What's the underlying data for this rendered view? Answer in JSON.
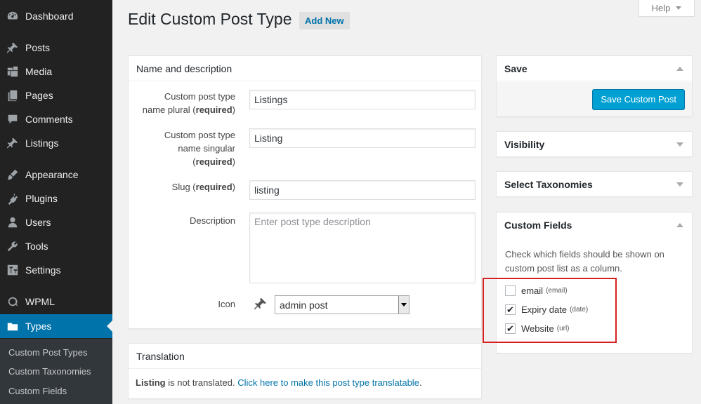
{
  "sidebar": {
    "items": [
      {
        "label": "Dashboard",
        "icon": "dashboard-icon"
      },
      {
        "label": "Posts",
        "icon": "pin-icon"
      },
      {
        "label": "Media",
        "icon": "media-icon"
      },
      {
        "label": "Pages",
        "icon": "pages-icon"
      },
      {
        "label": "Comments",
        "icon": "comment-icon"
      },
      {
        "label": "Listings",
        "icon": "pin-icon"
      },
      {
        "label": "Appearance",
        "icon": "brush-icon"
      },
      {
        "label": "Plugins",
        "icon": "plugin-icon"
      },
      {
        "label": "Users",
        "icon": "user-icon"
      },
      {
        "label": "Tools",
        "icon": "wrench-icon"
      },
      {
        "label": "Settings",
        "icon": "settings-icon"
      },
      {
        "label": "WPML",
        "icon": "wpml-icon"
      },
      {
        "label": "Types",
        "icon": "folder-icon"
      }
    ],
    "submenu": [
      "Custom Post Types",
      "Custom Taxonomies",
      "Custom Fields"
    ]
  },
  "header": {
    "title": "Edit Custom Post Type",
    "add_new": "Add New",
    "help": "Help"
  },
  "name_box": {
    "title": "Name and description",
    "plural_label_line1": "Custom post type",
    "plural_label_line2": "name plural (",
    "required": "required",
    "close_paren": ")",
    "plural_value": "Listings",
    "singular_label_line1": "Custom post type",
    "singular_label_line2": "name singular",
    "singular_label_line3": "(",
    "singular_value": "Listing",
    "slug_label": "Slug (",
    "slug_value": "listing",
    "description_label": "Description",
    "description_placeholder": "Enter post type description",
    "icon_label": "Icon",
    "icon_value": "admin post"
  },
  "translation_box": {
    "title": "Translation",
    "bold": "Listing",
    "text": " is not translated. ",
    "link": "Click here to make this post type translatable",
    "period": "."
  },
  "save_box": {
    "title": "Save",
    "button": "Save Custom Post"
  },
  "visibility_box": {
    "title": "Visibility"
  },
  "taxonomies_box": {
    "title": "Select Taxonomies"
  },
  "custom_fields_box": {
    "title": "Custom Fields",
    "help_line1": "Check which fields should be shown on",
    "help_line2": "custom post list as a column.",
    "fields": [
      {
        "label": "email",
        "type": "(email)",
        "checked": false
      },
      {
        "label": "Expiry date",
        "type": "(date)",
        "checked": true
      },
      {
        "label": "Website",
        "type": "(url)",
        "checked": true
      }
    ]
  },
  "colors": {
    "active_menu": "#0073aa",
    "primary_button": "#00a0d2",
    "highlight": "#d61f1f"
  }
}
